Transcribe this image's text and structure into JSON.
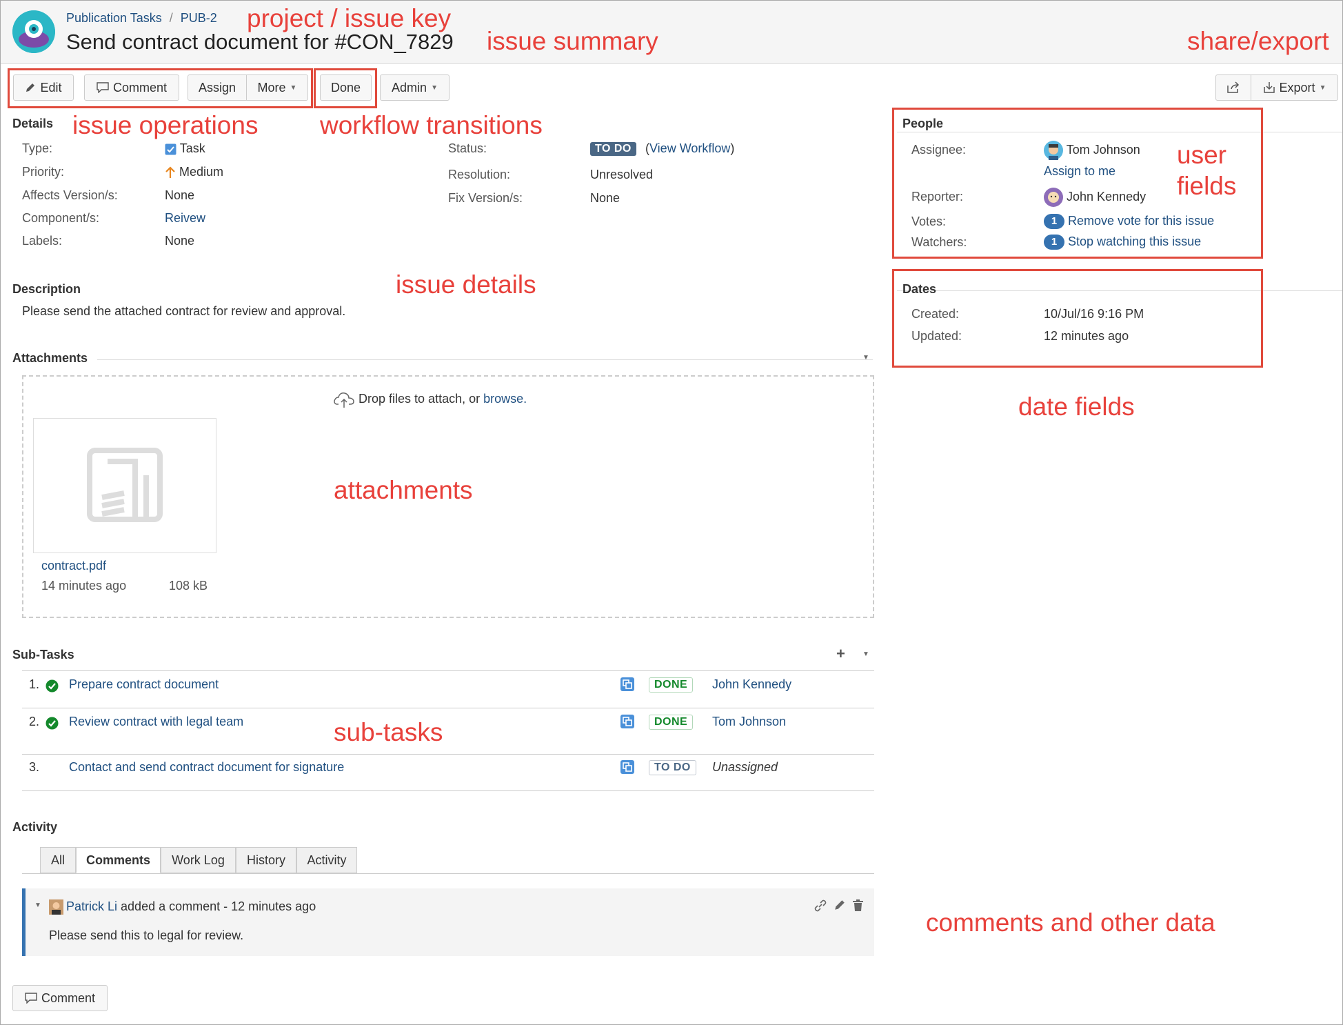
{
  "header": {
    "project": "Publication Tasks",
    "separator": "/",
    "issue_key": "PUB-2",
    "summary": "Send contract document for #CON_7829"
  },
  "toolbar": {
    "edit": "Edit",
    "comment": "Comment",
    "assign": "Assign",
    "more": "More",
    "done": "Done",
    "admin": "Admin",
    "export": "Export"
  },
  "annotations": {
    "project_key": "project / issue key",
    "issue_summary": "issue summary",
    "share_export": "share/export",
    "issue_operations": "issue operations",
    "workflow_transitions": "workflow transitions",
    "user_fields_1": "user",
    "user_fields_2": "fields",
    "issue_details": "issue details",
    "date_fields": "date fields",
    "attachments": "attachments",
    "sub_tasks": "sub-tasks",
    "comments": "comments and other data"
  },
  "details": {
    "heading": "Details",
    "type_label": "Type:",
    "type_value": "Task",
    "priority_label": "Priority:",
    "priority_value": "Medium",
    "affects_label": "Affects Version/s:",
    "affects_value": "None",
    "component_label": "Component/s:",
    "component_value": "Reivew",
    "labels_label": "Labels:",
    "labels_value": "None",
    "status_label": "Status:",
    "status_value": "TO DO",
    "view_workflow": "View Workflow",
    "resolution_label": "Resolution:",
    "resolution_value": "Unresolved",
    "fix_label": "Fix Version/s:",
    "fix_value": "None",
    "colors": {
      "todo_badge": "#4a6785",
      "done_badge": "#14892c",
      "link": "#205081"
    }
  },
  "people": {
    "heading": "People",
    "assignee_label": "Assignee:",
    "assignee_value": "Tom Johnson",
    "assign_to_me": "Assign to me",
    "reporter_label": "Reporter:",
    "reporter_value": "John Kennedy",
    "votes_label": "Votes:",
    "votes_count": "1",
    "votes_link": "Remove vote for this issue",
    "watchers_label": "Watchers:",
    "watchers_count": "1",
    "watchers_link": "Stop watching this issue"
  },
  "dates": {
    "heading": "Dates",
    "created_label": "Created:",
    "created_value": "10/Jul/16 9:16 PM",
    "updated_label": "Updated:",
    "updated_value": "12 minutes ago"
  },
  "description": {
    "heading": "Description",
    "text": "Please send the attached contract for review and approval."
  },
  "attachments": {
    "heading": "Attachments",
    "drop_text": "Drop files to attach, or ",
    "browse": "browse.",
    "file_name": "contract.pdf",
    "file_age": "14 minutes ago",
    "file_size": "108 kB"
  },
  "subtasks": {
    "heading": "Sub-Tasks",
    "items": [
      {
        "num": "1.",
        "title": "Prepare contract document",
        "status": "DONE",
        "assignee": "John Kennedy"
      },
      {
        "num": "2.",
        "title": "Review contract with legal team",
        "status": "DONE",
        "assignee": "Tom Johnson"
      },
      {
        "num": "3.",
        "title": "Contact and send contract document for signature",
        "status": "TO DO",
        "assignee": "Unassigned"
      }
    ]
  },
  "activity": {
    "heading": "Activity",
    "tabs": [
      "All",
      "Comments",
      "Work Log",
      "History",
      "Activity"
    ],
    "comment_author": "Patrick Li",
    "comment_meta": " added a comment - 12 minutes ago",
    "comment_text": "Please send this to legal for review.",
    "comment_button": "Comment"
  }
}
